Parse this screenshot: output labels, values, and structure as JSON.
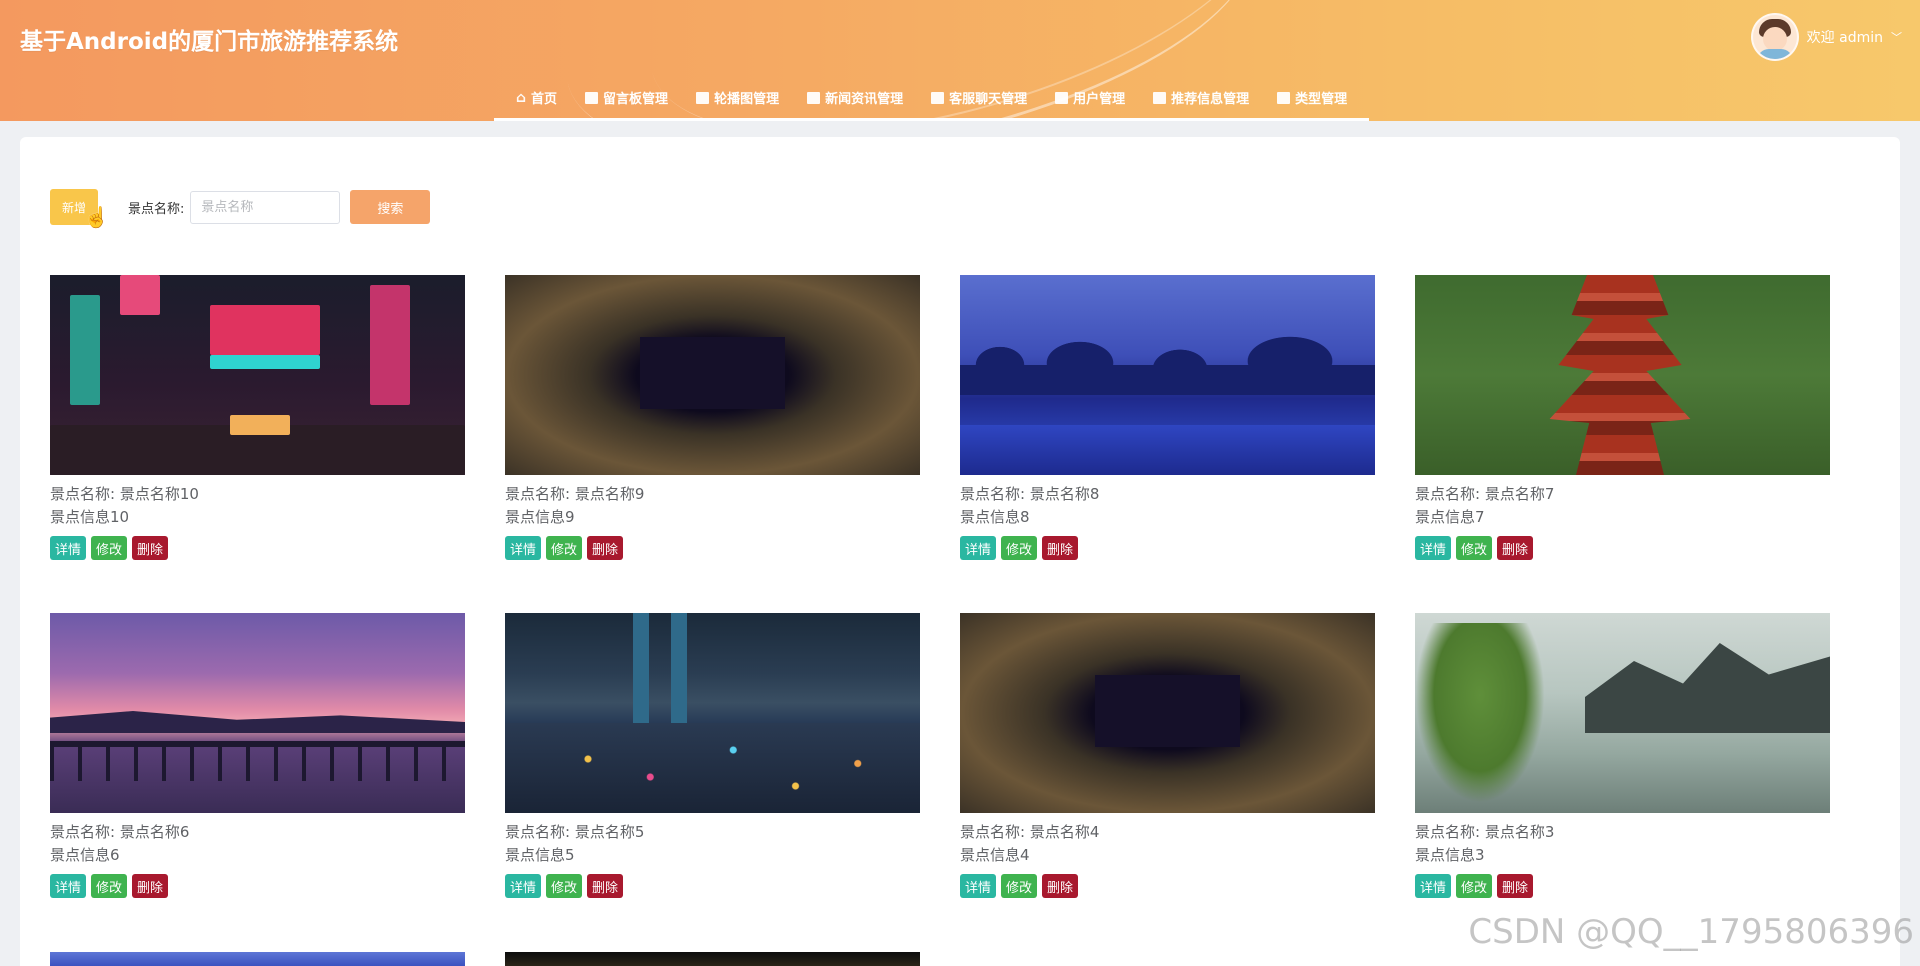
{
  "header": {
    "title": "基于Android的厦门市旅游推荐系统",
    "greeting": "欢迎 admin",
    "caret": "﹀"
  },
  "nav": [
    {
      "label": "首页",
      "icon": "home-icon"
    },
    {
      "label": "留言板管理",
      "icon": "board-icon"
    },
    {
      "label": "轮播图管理",
      "icon": "carousel-icon"
    },
    {
      "label": "新闻资讯管理",
      "icon": "news-icon"
    },
    {
      "label": "客服聊天管理",
      "icon": "chat-icon"
    },
    {
      "label": "用户管理",
      "icon": "user-icon"
    },
    {
      "label": "推荐信息管理",
      "icon": "recommend-icon"
    },
    {
      "label": "类型管理",
      "icon": "type-icon"
    }
  ],
  "toolbar": {
    "add_label": "新增",
    "search_label": "景点名称:",
    "search_placeholder": "景点名称",
    "search_button": "搜索"
  },
  "card_actions": {
    "detail": "详情",
    "edit": "修改",
    "delete": "删除"
  },
  "cards": [
    {
      "name": "景点名称:  景点名称10",
      "info": "景点信息10"
    },
    {
      "name": "景点名称:  景点名称9",
      "info": "景点信息9"
    },
    {
      "name": "景点名称:  景点名称8",
      "info": "景点信息8"
    },
    {
      "name": "景点名称:  景点名称7",
      "info": "景点信息7"
    },
    {
      "name": "景点名称:  景点名称6",
      "info": "景点信息6"
    },
    {
      "name": "景点名称:  景点名称5",
      "info": "景点信息5"
    },
    {
      "name": "景点名称:  景点名称4",
      "info": "景点信息4"
    },
    {
      "name": "景点名称:  景点名称3",
      "info": "景点信息3"
    }
  ],
  "watermark": "CSDN @QQ__1795806396",
  "colors": {
    "header_start": "#f4995f",
    "header_end": "#f7c86b",
    "add_button": "#f9c64a",
    "search_button": "#f5a46a",
    "detail_button": "#2ab7a1",
    "edit_button": "#3fb34f",
    "delete_button": "#a8192e"
  }
}
